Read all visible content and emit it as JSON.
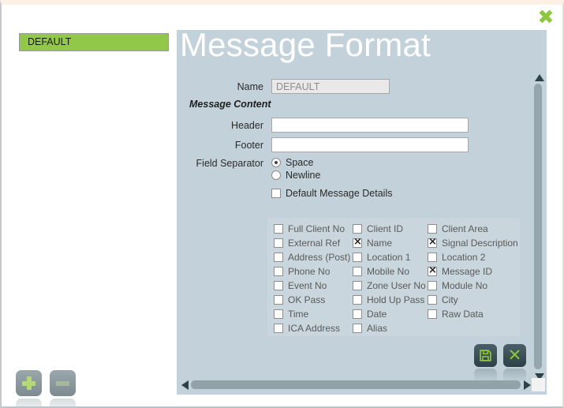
{
  "window": {
    "close_label": "✖"
  },
  "sidebar": {
    "items": [
      {
        "label": "DEFAULT",
        "selected": true
      }
    ],
    "add_button": "+",
    "remove_button": "−"
  },
  "panel": {
    "title": "Message Format",
    "name_label": "Name",
    "name_value": "DEFAULT",
    "section_header": "Message Content",
    "header_label": "Header",
    "header_value": "",
    "footer_label": "Footer",
    "footer_value": "",
    "field_separator_label": "Field Separator",
    "separator_options": [
      {
        "label": "Space",
        "selected": true
      },
      {
        "label": "Newline",
        "selected": false
      }
    ],
    "default_message_details": {
      "label": "Default Message Details",
      "checked": false
    }
  },
  "fields_grid": {
    "rows": [
      [
        {
          "label": "Full Client No",
          "checked": false
        },
        {
          "label": "Client ID",
          "checked": false
        },
        {
          "label": "Client Area",
          "checked": false
        }
      ],
      [
        {
          "label": "External Ref",
          "checked": false
        },
        {
          "label": "Name",
          "checked": true
        },
        {
          "label": "Signal Description",
          "checked": true
        }
      ],
      [
        {
          "label": "Address (Post)",
          "checked": false
        },
        {
          "label": "Location 1",
          "checked": false
        },
        {
          "label": "Location 2",
          "checked": false
        }
      ],
      [
        {
          "label": "Phone No",
          "checked": false
        },
        {
          "label": "Mobile No",
          "checked": false
        },
        {
          "label": "Message ID",
          "checked": true
        }
      ],
      [
        {
          "label": "Event No",
          "checked": false
        },
        {
          "label": "Zone User No",
          "checked": false
        },
        {
          "label": "Module No",
          "checked": false
        }
      ],
      [
        {
          "label": "OK Pass",
          "checked": false
        },
        {
          "label": "Hold Up Pass",
          "checked": false
        },
        {
          "label": "City",
          "checked": false
        }
      ],
      [
        {
          "label": "Time",
          "checked": false
        },
        {
          "label": "Date",
          "checked": false
        },
        {
          "label": "Raw Data",
          "checked": false
        }
      ],
      [
        {
          "label": "ICA Address",
          "checked": false
        },
        {
          "label": "Alias",
          "checked": false
        }
      ]
    ]
  },
  "actions": {
    "save_icon": "floppy-disk-icon",
    "cancel_label": "✕"
  },
  "colors": {
    "accent_green": "#8dc63f",
    "list_green": "#92c84a",
    "panel_bg": "#c3d2da",
    "grid_bg": "#c9d6dd"
  }
}
